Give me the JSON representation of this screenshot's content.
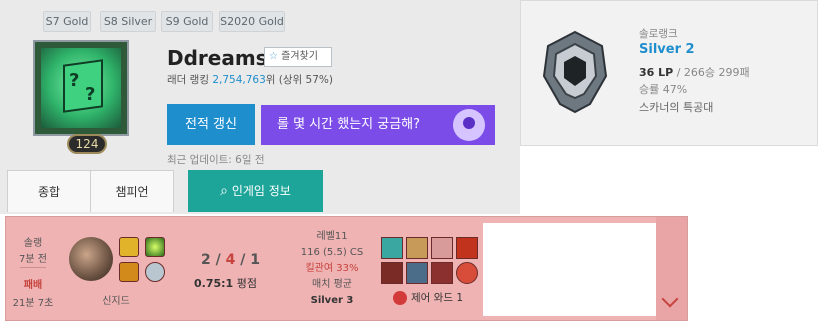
{
  "header": {
    "seasons": [
      {
        "label": "S7 Gold"
      },
      {
        "label": "S8 Silver"
      },
      {
        "label": "S9 Gold"
      },
      {
        "label": "S2020 Gold"
      }
    ],
    "profile_level": "124",
    "summoner_name": "Ddreams",
    "favorite_label": "즐겨찾기",
    "ladder_rank_prefix": "래더 랭킹 ",
    "ladder_rank_number": "2,754,763",
    "ladder_rank_suffix": "위 (상위 57%)",
    "refresh_label": "전적 갱신",
    "promo_label": "롤 몇 시간 했는지 궁금해?",
    "last_update": "최근 업데이트: 6일 전",
    "tabs": {
      "summary": "종합",
      "champions": "챔피언",
      "ingame": "인게임 정보"
    }
  },
  "rank": {
    "queue": "솔로랭크",
    "tier": "Silver 2",
    "lp": "36 LP",
    "record": " / 266승 299패",
    "win_rate": "승률 47%",
    "squad": "스카너의 특공대"
  },
  "match": {
    "queue_type": "솔랭",
    "time_ago": "7분 전",
    "result": "패배",
    "duration": "21분 7초",
    "champion": "신지드",
    "kda": {
      "kills": "2",
      "deaths": "4",
      "assists": "1"
    },
    "kda_ratio": "0.75:1",
    "kda_ratio_suffix": " 평점",
    "level": "레벨11",
    "cs": "116 (5.5) CS",
    "kill_participation": "킬관여 33%",
    "match_avg_label": "매치 평균",
    "match_avg_tier": "Silver 3",
    "control_ward": "제어 와드 1"
  },
  "colors": {
    "accent_blue": "#1f8ecd",
    "ingame_teal": "#1ea59a",
    "promo_purple": "#7b4ce8",
    "loss_bg": "#efb3b3",
    "loss_red": "#c6443e"
  }
}
